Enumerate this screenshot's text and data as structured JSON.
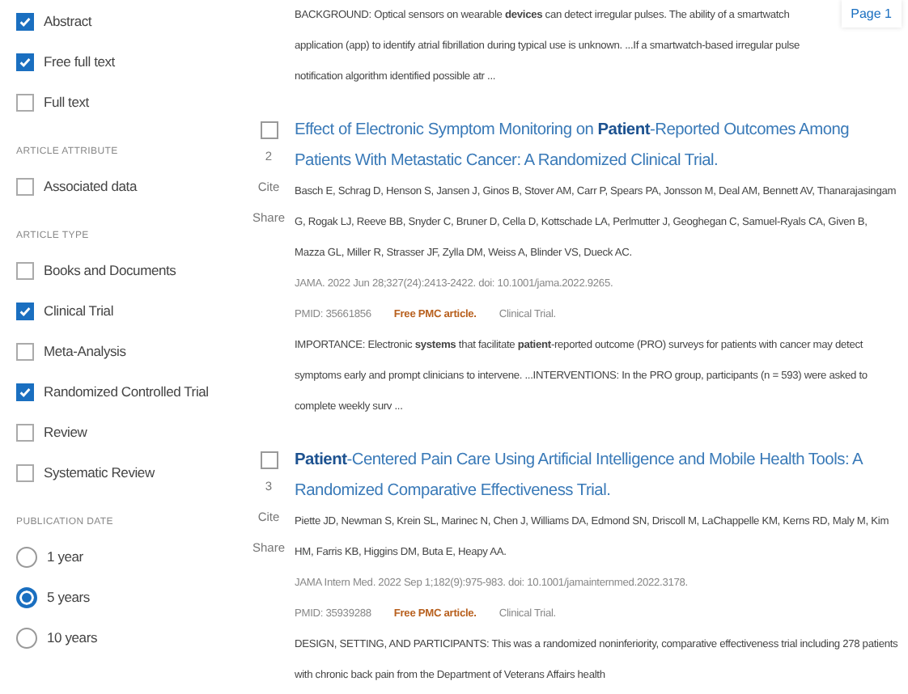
{
  "filters": [
    {
      "items": [
        {
          "label": "Abstract",
          "checked": true
        },
        {
          "label": "Free full text",
          "checked": true
        },
        {
          "label": "Full text",
          "checked": false
        }
      ]
    },
    {
      "heading": "ARTICLE ATTRIBUTE",
      "items": [
        {
          "label": "Associated data",
          "checked": false
        }
      ]
    },
    {
      "heading": "ARTICLE TYPE",
      "items": [
        {
          "label": "Books and Documents",
          "checked": false
        },
        {
          "label": "Clinical Trial",
          "checked": true
        },
        {
          "label": "Meta-Analysis",
          "checked": false
        },
        {
          "label": "Randomized Controlled Trial",
          "checked": true
        },
        {
          "label": "Review",
          "checked": false
        },
        {
          "label": "Systematic Review",
          "checked": false
        }
      ]
    }
  ],
  "publication_date": {
    "heading": "PUBLICATION DATE",
    "options": [
      {
        "label": "1 year",
        "selected": false
      },
      {
        "label": "5 years",
        "selected": true
      },
      {
        "label": "10 years",
        "selected": false
      }
    ]
  },
  "page_badge": "Page 1",
  "previous_snippet": "BACKGROUND: Optical sensors on wearable **devices** can detect irregular pulses. The ability of a smartwatch application (app) to identify atrial fibrillation during typical use is unknown. ...If a smartwatch-based irregular pulse notification algorithm identified possible atr ...",
  "results": [
    {
      "number": "2",
      "selected": false,
      "cite": "Cite",
      "share": "Share",
      "title": "Effect of Electronic Symptom Monitoring on **Patient**-Reported Outcomes Among Patients With Metastatic Cancer: A Randomized Clinical Trial.",
      "authors": "Basch E, Schrag D, Henson S, Jansen J, Ginos B, Stover AM, Carr P, Spears PA, Jonsson M, Deal AM, Bennett AV, Thanarajasingam G, Rogak LJ, Reeve BB, Snyder C, Bruner D, Cella D, Kottschade LA, Perlmutter J, Geoghegan C, Samuel-Ryals CA, Given B, Mazza GL, Miller R, Strasser JF, Zylla DM, Weiss A, Blinder VS, Dueck AC.",
      "citation": "JAMA. 2022 Jun 28;327(24):2413-2422. doi: 10.1001/jama.2022.9265.",
      "pmid": "PMID: 35661856",
      "free_pmc": "Free PMC article.",
      "type": "Clinical Trial.",
      "snippet": "IMPORTANCE: Electronic **systems** that facilitate **patient**-reported outcome (PRO) surveys for patients with cancer may detect symptoms early and prompt clinicians to intervene. ...INTERVENTIONS: In the PRO group, participants (n = 593) were asked to complete weekly surv ..."
    },
    {
      "number": "3",
      "selected": false,
      "cite": "Cite",
      "share": "Share",
      "title": "**Patient**-Centered Pain Care Using Artificial Intelligence and Mobile Health Tools: A Randomized Comparative Effectiveness Trial.",
      "authors": "Piette JD, Newman S, Krein SL, Marinec N, Chen J, Williams DA, Edmond SN, Driscoll M, LaChappelle KM, Kerns RD, Maly M, Kim HM, Farris KB, Higgins DM, Buta E, Heapy AA.",
      "citation": "JAMA Intern Med. 2022 Sep 1;182(9):975-983. doi: 10.1001/jamainternmed.2022.3178.",
      "pmid": "PMID: 35939288",
      "free_pmc": "Free PMC article.",
      "type": "Clinical Trial.",
      "snippet": "DESIGN, SETTING, AND PARTICIPANTS: This was a randomized noninferiority, comparative effectiveness trial including 278 patients with chronic back pain from the Department of Veterans Affairs health"
    }
  ]
}
